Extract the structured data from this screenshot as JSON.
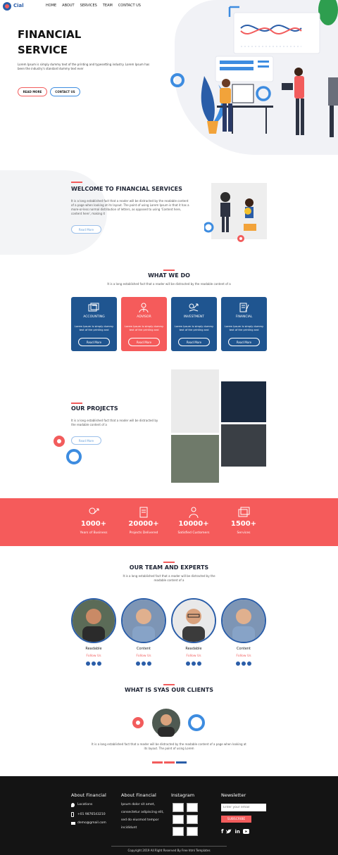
{
  "brand": {
    "name": "Cial",
    "primary": "#2a5da8",
    "accent": "#f25c5c"
  },
  "nav": {
    "items": [
      "HOME",
      "ABOUT",
      "SERVICES",
      "TEAM",
      "CONTACT US"
    ]
  },
  "hero": {
    "title_line1": "FINANCIAL",
    "title_line2": "SERVICE",
    "description": "Lorem Ipsum is simply dummy text of the printing and typesetting industry. Lorem Ipsum has been the industry's standard dummy text ever",
    "read_more": "READ MORE",
    "contact_us": "CONTACT US"
  },
  "welcome": {
    "title": "WELCOME TO FINANCIAL SERVICES",
    "text": "It is a long established fact that a reader will be distracted by the readable content of a page when looking at its layout. The point of using Lorem Ipsum is that it has a more-or-less normal distribution of letters, as opposed to using 'Content here, content here', making it",
    "button": "Read More"
  },
  "what_we_do": {
    "title": "WHAT WE DO",
    "subtitle": "It is a long established fact that a reader will be distracted by the readable content of a",
    "cards": [
      {
        "title": "ACCOUNTING",
        "text": "Lorem Ipsum is simply dummy text of the printing and",
        "button": "Read More",
        "icon": "accounting-icon"
      },
      {
        "title": "ADVISOR",
        "text": "Lorem Ipsum is simply dummy text of the printing and",
        "button": "Read More",
        "icon": "advisor-icon"
      },
      {
        "title": "INVESTMENT",
        "text": "Lorem Ipsum is simply dummy text of the printing and",
        "button": "Read More",
        "icon": "investment-icon"
      },
      {
        "title": "FINANCIAL",
        "text": "Lorem Ipsum is simply dummy text of the printing and",
        "button": "Read More",
        "icon": "financial-icon"
      }
    ]
  },
  "projects": {
    "title": "OUR PROJECTS",
    "text": "It is a long established fact that a reader will be distracted by the readable content of a",
    "button": "Read More"
  },
  "stats": [
    {
      "number": "1000+",
      "label": "Years of Business"
    },
    {
      "number": "20000+",
      "label": "Projects Delivered"
    },
    {
      "number": "10000+",
      "label": "Satisfied Customers"
    },
    {
      "number": "1500+",
      "label": "Services"
    }
  ],
  "team": {
    "title": "OUR TEAM AND EXPERTS",
    "subtitle_line1": "It is a long established fact that a reader will be distracted by the",
    "subtitle_line2": "readable content of a",
    "members": [
      {
        "name": "Readable",
        "follow": "Follow Us"
      },
      {
        "name": "Content",
        "follow": "Follow Us"
      },
      {
        "name": "Readable",
        "follow": "Follow Us"
      },
      {
        "name": "Content",
        "follow": "Follow Us"
      }
    ]
  },
  "clients": {
    "title": "WHAT IS SYAS OUR CLIENTS",
    "text_line1": "It is a long established fact that a reader will be distracted by the readable content of a page when looking at",
    "text_line2": "its layout. The point of using Lorem"
  },
  "footer": {
    "about_title": "About Financial",
    "location": "Locations",
    "phone": "+01 9876543210",
    "email": "demo@gmail.com",
    "about2_title": "About Financial",
    "about2_lines": [
      "Ipsum dolor sit amet,",
      "consectetur adipiscing elit,",
      "sed do eiusmod tempor",
      "incididunt"
    ],
    "instagram_title": "Instagram",
    "newsletter_title": "Newsletter",
    "email_placeholder": "Enter your email",
    "subscribe": "SUBSCRIBE",
    "copyright": "Copyright 2019 All Right Reserved By Free html Templates"
  }
}
